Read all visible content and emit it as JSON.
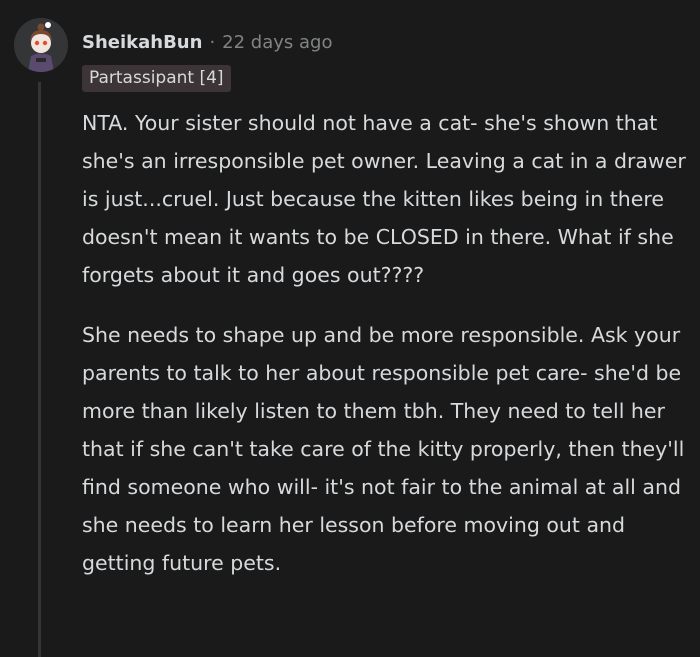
{
  "comment": {
    "username": "SheikahBun",
    "separator": "·",
    "timestamp": "22 days ago",
    "flair": "Partassipant [4]",
    "paragraphs": [
      "NTA. Your sister should not have a cat- she's shown that she's an irresponsible pet owner. Leaving a cat in a drawer is just...cruel. Just because the kitten likes being in there doesn't mean it wants to be CLOSED in there. What if she forgets about it and goes out????",
      "She needs to shape up and be more responsible. Ask your parents to talk to her about responsible pet care- she'd be more than likely listen to them tbh. They need to tell her that if she can't take care of the kitty properly, then they'll find someone who will- it's not fair to the animal at all and she needs to learn her lesson before moving out and getting future pets."
    ]
  },
  "colors": {
    "background": "#1a1a1b",
    "text": "#d7dadc",
    "muted": "#818384",
    "flair_background": "#3c3436",
    "thread_line": "#343536"
  }
}
